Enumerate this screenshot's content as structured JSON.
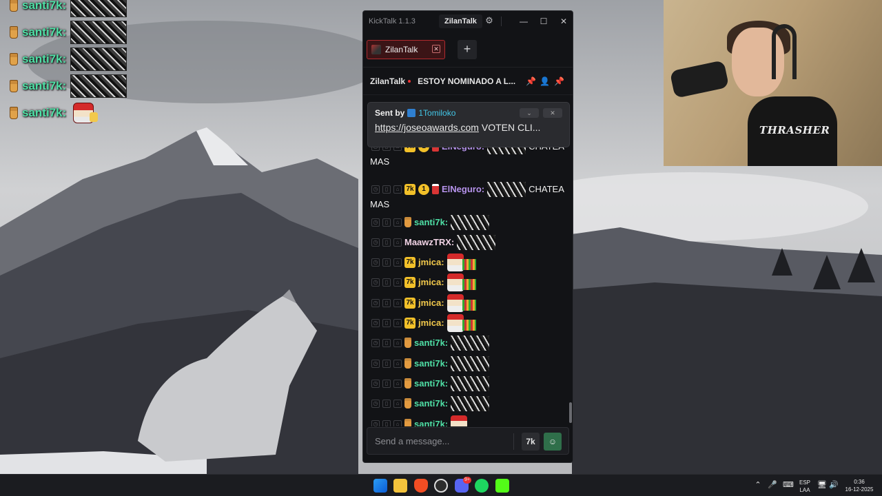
{
  "overlay": {
    "rows": [
      {
        "user": "santi7k:",
        "emote": "bw"
      },
      {
        "user": "santi7k:",
        "emote": "bw"
      },
      {
        "user": "santi7k:",
        "emote": "bw"
      },
      {
        "user": "santi7k:",
        "emote": "bw"
      },
      {
        "user": "santi7k:",
        "emote": "santa"
      }
    ],
    "name_color": "#4fe0a6"
  },
  "app": {
    "title": "KickTalk 1.1.3",
    "account": "ZilanTalk",
    "tab": {
      "label": "ZilanTalk"
    },
    "header": {
      "channel": "ZilanTalk",
      "stream_title": "ESTOY NOMINADO A L..."
    },
    "pinned": {
      "sent_by_label": "Sent by",
      "user": "1Tomiloko",
      "link": "https://joseoawards.com",
      "text": " VOTEN CLI..."
    },
    "messages": [
      {
        "badges": [
          "k",
          "1",
          "soda"
        ],
        "user": "ElNeguro:",
        "color": "#b693ec",
        "emote": "bw",
        "text": "CHATEA",
        "cont": "MAS"
      },
      {
        "badges": [
          "k",
          "1",
          "soda"
        ],
        "user": "ElNeguro:",
        "color": "#b693ec",
        "emote": "bw",
        "text": "CHATEA",
        "cont": "MAS"
      },
      {
        "badges": [
          "cup"
        ],
        "user": "santi7k:",
        "color": "#4fe0a6",
        "emote": "bw"
      },
      {
        "badges": [],
        "user": "MaawzTRX:",
        "color": "#f2d4e6",
        "emote": "bw"
      },
      {
        "badges": [
          "k"
        ],
        "user": "jmica:",
        "color": "#f2c94c",
        "emote": "santa"
      },
      {
        "badges": [
          "k"
        ],
        "user": "jmica:",
        "color": "#f2c94c",
        "emote": "santa"
      },
      {
        "badges": [
          "k"
        ],
        "user": "jmica:",
        "color": "#f2c94c",
        "emote": "santa"
      },
      {
        "badges": [
          "k"
        ],
        "user": "jmica:",
        "color": "#f2c94c",
        "emote": "santa"
      },
      {
        "badges": [
          "cup"
        ],
        "user": "santi7k:",
        "color": "#4fe0a6",
        "emote": "bw"
      },
      {
        "badges": [
          "cup"
        ],
        "user": "santi7k:",
        "color": "#4fe0a6",
        "emote": "bw"
      },
      {
        "badges": [
          "cup"
        ],
        "user": "santi7k:",
        "color": "#4fe0a6",
        "emote": "bw"
      },
      {
        "badges": [
          "cup"
        ],
        "user": "santi7k:",
        "color": "#4fe0a6",
        "emote": "bw"
      },
      {
        "badges": [
          "cup"
        ],
        "user": "santi7k:",
        "color": "#4fe0a6",
        "emote": "santa"
      }
    ],
    "composer": {
      "placeholder": "Send a message..."
    },
    "accent": "#b12a2e"
  },
  "webcam": {
    "shirt_text": "THRASHER"
  },
  "taskbar": {
    "apps": [
      "windows-start-icon",
      "file-explorer-icon",
      "brave-browser-icon",
      "obs-icon",
      "discord-icon",
      "spotify-icon",
      "kick-icon"
    ],
    "discord_badge": "9+",
    "lang": "ESP",
    "layout": "LAA",
    "time": "0:36",
    "date": "16-12-2025"
  }
}
